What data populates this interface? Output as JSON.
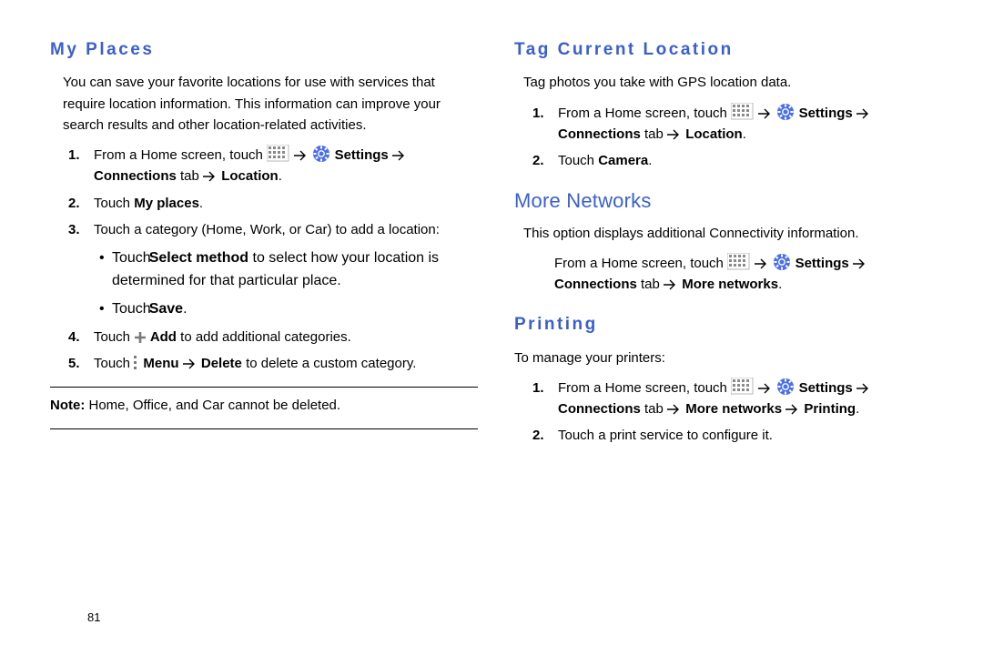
{
  "page_number": "81",
  "left": {
    "heading_my_places": "My Places",
    "intro": "You can save your favorite locations for use with services that require location information. This information can improve your search results and other location-related activities.",
    "step1_a": "From a Home screen, touch ",
    "step1_b": " Settings ",
    "step1_c": "Connections",
    "step1_d": " tab ",
    "step1_e": "Location",
    "step1_f": ".",
    "step2_a": "Touch ",
    "step2_b": "My places",
    "step2_c": ".",
    "step3_a": "Touch a category (Home, Work, or Car) to add a location:",
    "sub1_a": "Touch",
    "sub1_b": "Select method",
    "sub1_c": " to select how your location is determined for that particular place.",
    "sub2_a": "Touch",
    "sub2_b": "Save",
    "sub2_c": ".",
    "step4_a": "Touch ",
    "step4_b": " Add",
    "step4_c": " to add additional categories.",
    "step5_a": "Touch ",
    "step5_b": " Menu ",
    "step5_c": "Delete",
    "step5_d": " to delete a custom category.",
    "note_prefix": "Note:",
    "note_body": " Home, Office, and Car cannot be deleted."
  },
  "right": {
    "heading_tag": "Tag Current Location",
    "tag_intro": "Tag photos you take with GPS location data.",
    "t_step1_a": "From a Home screen, touch ",
    "t_step1_b": " Settings ",
    "t_step1_c": "Connections",
    "t_step1_d": " tab ",
    "t_step1_e": "Location",
    "t_step1_f": ".",
    "t_step2_a": "Touch ",
    "t_step2_b": "Camera",
    "t_step2_c": ".",
    "heading_more": "More Networks",
    "more_intro": "This option displays additional Connectivity information.",
    "m_step_a": "From a Home screen, touch ",
    "m_step_b": " Settings ",
    "m_step_c": "Connections",
    "m_step_d": " tab ",
    "m_step_e": "More networks",
    "m_step_f": ".",
    "heading_print": "Printing",
    "print_intro": "To manage your printers:",
    "p_step1_a": "From a Home screen, touch ",
    "p_step1_b": " Settings ",
    "p_step1_c": "Connections",
    "p_step1_d": " tab ",
    "p_step1_e": "More networks ",
    "p_step1_f": "Printing",
    "p_step1_g": ".",
    "p_step2": "Touch a print service to configure it."
  }
}
